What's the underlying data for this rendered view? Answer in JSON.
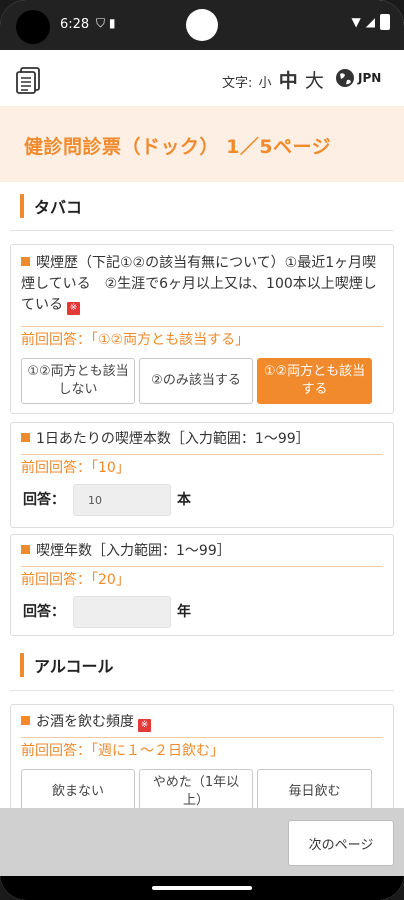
{
  "status": {
    "time": "6:28"
  },
  "header": {
    "font_size_label": "文字:",
    "font_small": "小",
    "font_mid": "中",
    "font_large": "大",
    "language": "JPN"
  },
  "page_title": "健診問診票（ドック） 1／5ページ",
  "sections": {
    "tobacco": "タバコ",
    "alcohol": "アルコール"
  },
  "questions": {
    "smoking_history": {
      "text": "喫煙歴（下記①②の該当有無について）①最近1ヶ月喫煙している　②生涯で6ヶ月以上又は、100本以上喫煙している",
      "required_badge": "※",
      "previous_answer": "前回回答：「①②両方とも該当する」",
      "choices": [
        "①②両方とも該当しない",
        "②のみ該当する",
        "①②両方とも該当する"
      ],
      "selected_index": 2
    },
    "cigarettes_per_day": {
      "text": "1日あたりの喫煙本数［入力範囲：1〜99］",
      "previous_answer": "前回回答：「10」",
      "answer_label": "回答：",
      "placeholder": "10",
      "unit": "本"
    },
    "smoking_years": {
      "text": "喫煙年数［入力範囲：1〜99］",
      "previous_answer": "前回回答：「20」",
      "answer_label": "回答：",
      "placeholder": "",
      "unit": "年"
    },
    "drinking_frequency": {
      "text": "お酒を飲む頻度",
      "required_badge": "※",
      "previous_answer": "前回回答：「週に１〜２日飲む」",
      "choices": [
        "飲まない",
        "やめた（1年以上）",
        "毎日飲む"
      ]
    }
  },
  "footer": {
    "next_button": "次のページ"
  },
  "colors": {
    "accent": "#f08a2c",
    "title_band": "#fdefe3",
    "required": "#e53935"
  }
}
